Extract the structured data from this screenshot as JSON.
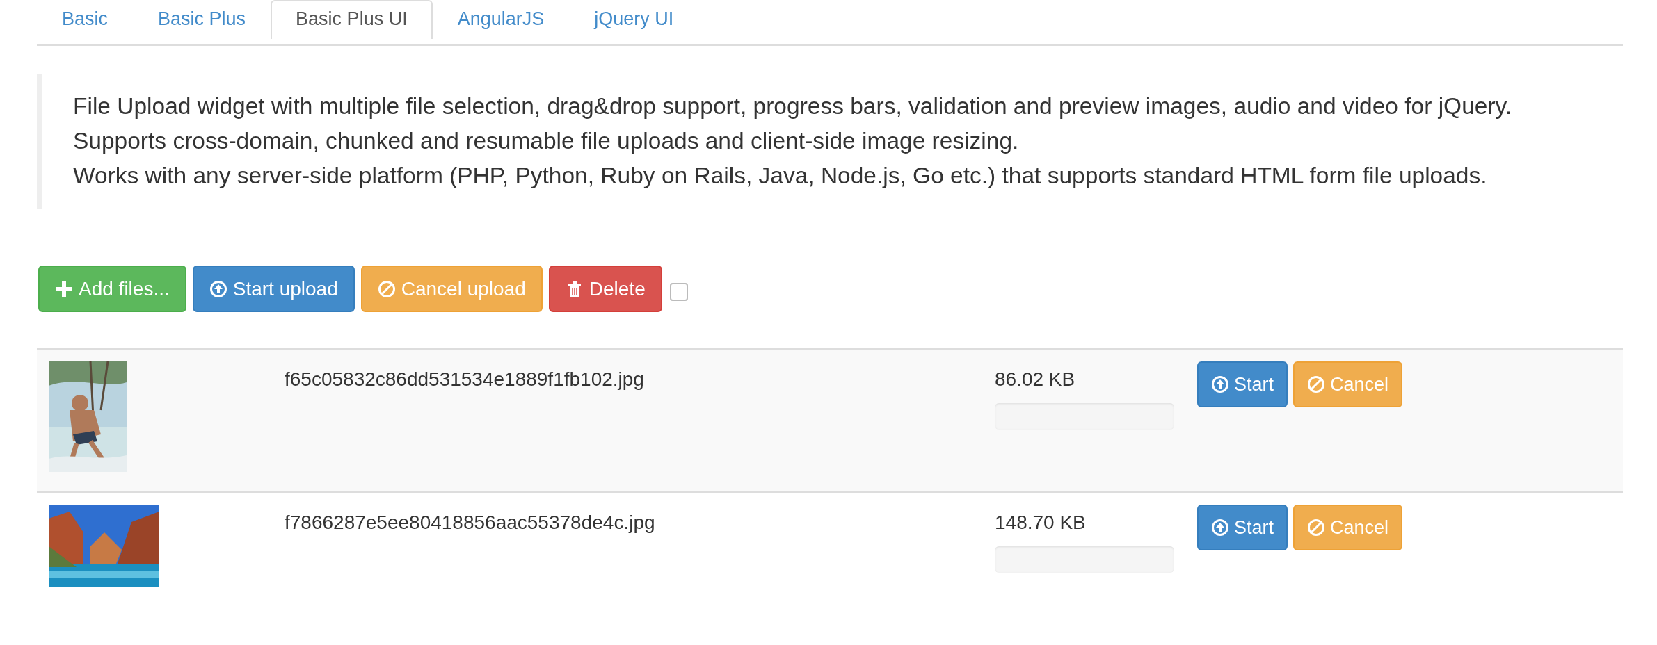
{
  "tabs": [
    {
      "label": "Basic",
      "selected": false
    },
    {
      "label": "Basic Plus",
      "selected": false
    },
    {
      "label": "Basic Plus UI",
      "selected": true
    },
    {
      "label": "AngularJS",
      "selected": false
    },
    {
      "label": "jQuery UI",
      "selected": false
    }
  ],
  "description": [
    "File Upload widget with multiple file selection, drag&drop support, progress bars, validation and preview images, audio and video for jQuery.",
    "Supports cross-domain, chunked and resumable file uploads and client-side image resizing.",
    "Works with any server-side platform (PHP, Python, Ruby on Rails, Java, Node.js, Go etc.) that supports standard HTML form file uploads."
  ],
  "toolbar": {
    "buttons": [
      {
        "kind": "add",
        "label": "Add files..."
      },
      {
        "kind": "start",
        "label": "Start upload"
      },
      {
        "kind": "cancel",
        "label": "Cancel upload"
      },
      {
        "kind": "delete",
        "label": "Delete"
      }
    ],
    "select_all": {
      "checked": false
    }
  },
  "files": [
    {
      "preview": {
        "kind": "picture"
      },
      "name": "f65c05832c86dd531534e1889f1fb102.jpg",
      "size": "86.02 KB",
      "level": 0,
      "buttons": [
        {
          "kind": "start",
          "label": "Start"
        },
        {
          "kind": "cancel",
          "label": "Cancel"
        }
      ]
    },
    {
      "preview": {
        "kind": "picture"
      },
      "name": "f7866287e5ee80418856aac55378de4c.jpg",
      "size": "148.70 KB",
      "level": 0,
      "buttons": [
        {
          "kind": "start",
          "label": "Start"
        },
        {
          "kind": "cancel",
          "label": "Cancel"
        }
      ]
    }
  ]
}
